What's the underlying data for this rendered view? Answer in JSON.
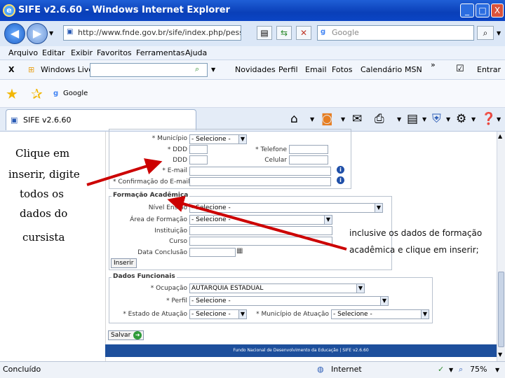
{
  "window": {
    "title": "SIFE v2.6.60 - Windows Internet Explorer",
    "minimize": "_",
    "maximize": "□",
    "close": "X"
  },
  "address_bar": {
    "url": "http://www.fnde.gov.br/sife/index.php/pessoa/crea",
    "search_placeholder": "Google"
  },
  "menu": {
    "items": [
      "Arquivo",
      "Editar",
      "Exibir",
      "Favoritos",
      "Ferramentas",
      "Ajuda"
    ]
  },
  "live_toolbar": {
    "close": "X",
    "brand": "Windows Live",
    "items": [
      "Novidades",
      "Perfil",
      "Email",
      "Fotos",
      "Calendário",
      "MSN"
    ],
    "more": "»",
    "enter": "Entrar"
  },
  "favorites_bar": {
    "google": "Google"
  },
  "tab": {
    "label": "SIFE v2.6.60"
  },
  "annotations": {
    "left_lines": [
      "Clique em",
      "inserir, digite",
      "todos os",
      "dados do",
      "cursista"
    ],
    "right_lines": [
      "inclusive os dados de formação",
      "acadêmica e clique em inserir;"
    ]
  },
  "form": {
    "contact": {
      "municipio_label": "* Município",
      "municipio_value": "- Selecione -",
      "ddd1_label": "* DDD",
      "telefone_label": "* Telefone",
      "ddd2_label": "DDD",
      "celular_label": "Celular",
      "email_label": "* E-mail",
      "email_confirm_label": "* Confirmação do E-mail"
    },
    "formacao": {
      "legend": "Formação Acadêmica",
      "nivel_label": "Nível Ensino",
      "nivel_value": "- Selecione -",
      "area_label": "Área de Formação",
      "area_value": "- Selecione -",
      "instituicao_label": "Instituição",
      "curso_label": "Curso",
      "data_label": "Data Conclusão",
      "inserir_button": "Inserir"
    },
    "funcionais": {
      "legend": "Dados Funcionais",
      "ocupacao_label": "* Ocupação",
      "ocupacao_value": "AUTARQUIA ESTADUAL",
      "perfil_label": "* Perfil",
      "perfil_value": "- Selecione -",
      "estado_label": "* Estado de Atuação",
      "estado_value": "- Selecione -",
      "municipio_atuacao_label": "* Município de Atuação",
      "municipio_atuacao_value": "- Selecione -"
    },
    "salvar_button": "Salvar"
  },
  "footer": {
    "text": "Fundo Nacional de Desenvolvimento da Educação | SIFE v2.6.60"
  },
  "status_bar": {
    "status": "Concluído",
    "zone": "Internet",
    "zoom": "75%"
  },
  "colors": {
    "titlebar": "#0a3fb8",
    "footer": "#1d4f9c",
    "arrow": "#cc0000"
  }
}
